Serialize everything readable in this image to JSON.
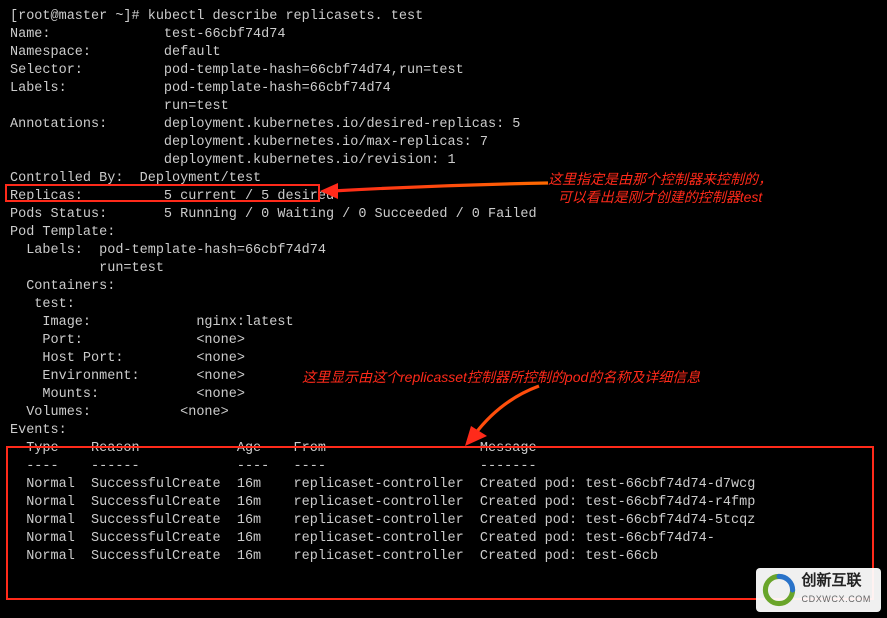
{
  "prompt": "[root@master ~]# kubectl describe replicasets. test",
  "fields": {
    "Name": "test-66cbf74d74",
    "Namespace": "default",
    "Selector": "pod-template-hash=66cbf74d74,run=test",
    "Labels": "pod-template-hash=66cbf74d74",
    "LabelsCont": "run=test",
    "Annotations": "deployment.kubernetes.io/desired-replicas: 5",
    "AnnotationsCont1": "deployment.kubernetes.io/max-replicas: 7",
    "AnnotationsCont2": "deployment.kubernetes.io/revision: 1",
    "ControlledBy": "Deployment/test",
    "Replicas": "5 current / 5 desired",
    "PodsStatus": "5 Running / 0 Waiting / 0 Succeeded / 0 Failed",
    "PodTemplateHeader": "Pod Template:",
    "TplLabels1": "pod-template-hash=66cbf74d74",
    "TplLabels2": "run=test",
    "Containers": "Containers:",
    "ContainerName": "test:",
    "Image": "nginx:latest",
    "Port": "<none>",
    "HostPort": "<none>",
    "Environment": "<none>",
    "Mounts": "<none>",
    "Volumes": "<none>",
    "EventsHeader": "Events:"
  },
  "eventsHeaderRow": {
    "Type": "Type",
    "Reason": "Reason",
    "Age": "Age",
    "From": "From",
    "Message": "Message"
  },
  "eventsDashRow": {
    "Type": "----",
    "Reason": "------",
    "Age": "----",
    "From": "----",
    "Message": "-------"
  },
  "events": [
    {
      "Type": "Normal",
      "Reason": "SuccessfulCreate",
      "Age": "16m",
      "From": "replicaset-controller",
      "Message": "Created pod: test-66cbf74d74-d7wcg"
    },
    {
      "Type": "Normal",
      "Reason": "SuccessfulCreate",
      "Age": "16m",
      "From": "replicaset-controller",
      "Message": "Created pod: test-66cbf74d74-r4fmp"
    },
    {
      "Type": "Normal",
      "Reason": "SuccessfulCreate",
      "Age": "16m",
      "From": "replicaset-controller",
      "Message": "Created pod: test-66cbf74d74-5tcqz"
    },
    {
      "Type": "Normal",
      "Reason": "SuccessfulCreate",
      "Age": "16m",
      "From": "replicaset-controller",
      "Message": "Created pod: test-66cbf74d74-"
    },
    {
      "Type": "Normal",
      "Reason": "SuccessfulCreate",
      "Age": "16m",
      "From": "replicaset-controller",
      "Message": "Created pod: test-66cb"
    }
  ],
  "annotations": {
    "top1": "这里指定是由那个控制器来控制的，",
    "top2": "可以看出是刚才创建的控制器test",
    "mid": "这里显示由这个replicasset控制器所控制的pod的名称及详细信息"
  },
  "watermark": {
    "brand": "创新互联",
    "sub": "CDXWCX.COM"
  }
}
